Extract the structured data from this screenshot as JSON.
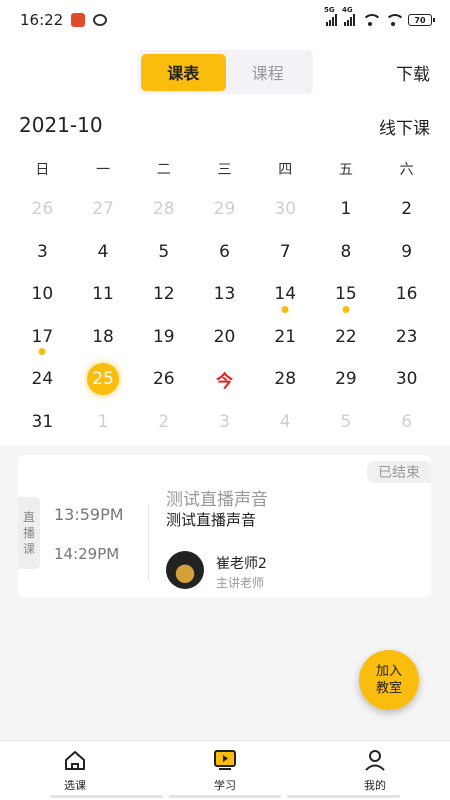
{
  "status_bar": {
    "time": "16:22",
    "net1": "5G",
    "net2": "4G",
    "battery": "70"
  },
  "header": {
    "tabs": [
      "课表",
      "课程"
    ],
    "active_tab": 0,
    "download": "下载"
  },
  "calendar": {
    "month": "2021-10",
    "mode": "线下课",
    "weekdays": [
      "日",
      "一",
      "二",
      "三",
      "四",
      "五",
      "六"
    ],
    "days": [
      {
        "label": "26",
        "muted": true
      },
      {
        "label": "27",
        "muted": true
      },
      {
        "label": "28",
        "muted": true
      },
      {
        "label": "29",
        "muted": true
      },
      {
        "label": "30",
        "muted": true
      },
      {
        "label": "1"
      },
      {
        "label": "2"
      },
      {
        "label": "3"
      },
      {
        "label": "4"
      },
      {
        "label": "5"
      },
      {
        "label": "6"
      },
      {
        "label": "7"
      },
      {
        "label": "8"
      },
      {
        "label": "9"
      },
      {
        "label": "10"
      },
      {
        "label": "11"
      },
      {
        "label": "12"
      },
      {
        "label": "13"
      },
      {
        "label": "14",
        "event": true
      },
      {
        "label": "15",
        "event": true
      },
      {
        "label": "16"
      },
      {
        "label": "17",
        "event": true
      },
      {
        "label": "18"
      },
      {
        "label": "19"
      },
      {
        "label": "20"
      },
      {
        "label": "21"
      },
      {
        "label": "22"
      },
      {
        "label": "23"
      },
      {
        "label": "24"
      },
      {
        "label": "25",
        "selected": true
      },
      {
        "label": "26"
      },
      {
        "label": "今",
        "today": true
      },
      {
        "label": "28"
      },
      {
        "label": "29"
      },
      {
        "label": "30"
      },
      {
        "label": "31"
      },
      {
        "label": "1",
        "muted": true
      },
      {
        "label": "2",
        "muted": true
      },
      {
        "label": "3",
        "muted": true
      },
      {
        "label": "4",
        "muted": true
      },
      {
        "label": "5",
        "muted": true
      },
      {
        "label": "6",
        "muted": true
      }
    ]
  },
  "lesson_card": {
    "status": "已结束",
    "tag": [
      "直",
      "播",
      "课"
    ],
    "start_time": "13:59PM",
    "end_time": "14:29PM",
    "title": "测试直播声音",
    "subtitle": "测试直播声音",
    "teacher_name": "崔老师2",
    "teacher_role": "主讲老师"
  },
  "join_button": [
    "加入",
    "教室"
  ],
  "bottom_nav": [
    {
      "label": "选课",
      "icon": "home-icon"
    },
    {
      "label": "学习",
      "icon": "study-icon"
    },
    {
      "label": "我的",
      "icon": "person-icon"
    }
  ],
  "colors": {
    "accent": "#fbbd0d",
    "today": "#e0211e"
  }
}
